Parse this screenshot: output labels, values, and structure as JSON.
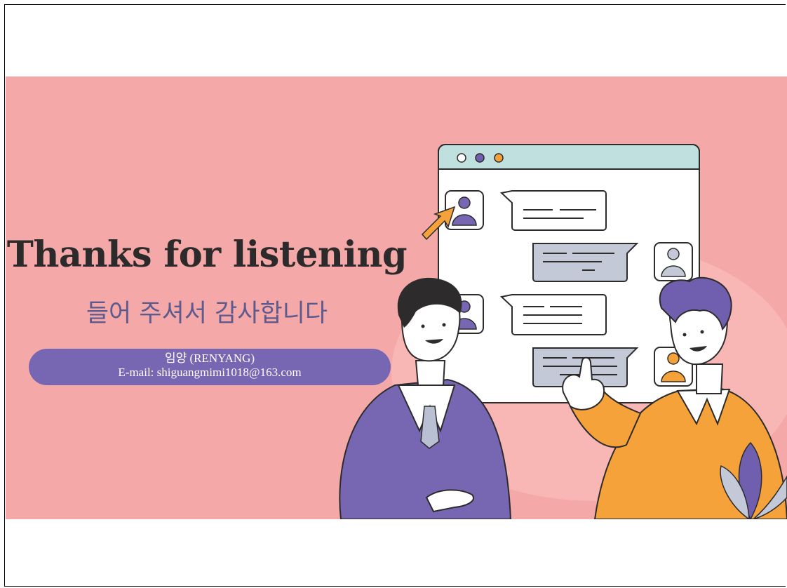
{
  "slide": {
    "title": "Thanks for listening",
    "subtitle": "들어 주셔서 감사합니다",
    "author": "임양 (RENYANG)",
    "email": "E-mail: shiguangmimi1018@163.com"
  },
  "colors": {
    "background": "#f4a9a8",
    "pill": "#7766b2",
    "title": "#2c2a2a",
    "subtitle": "#5d5a8e",
    "purple": "#6f5fae",
    "orange": "#f6a23a"
  },
  "icons": [
    "window-dot-icon",
    "user-avatar-icon",
    "cursor-arrow-icon",
    "chat-bubble-icon",
    "plant-leaf-icon"
  ]
}
